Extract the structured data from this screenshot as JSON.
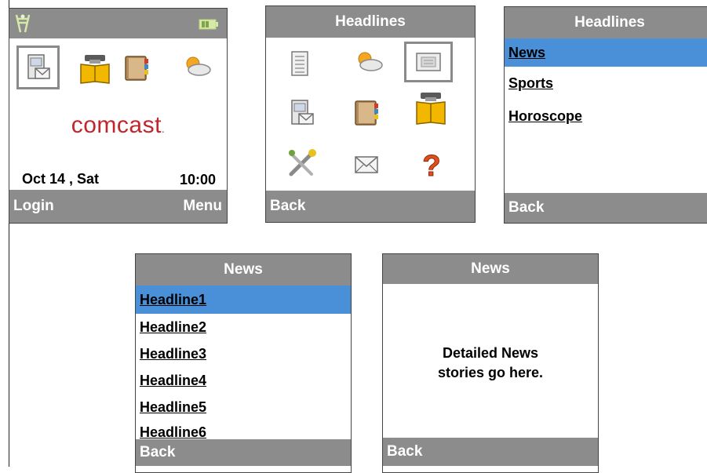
{
  "screen1": {
    "brand": "comcast",
    "brand_suffix": ".",
    "date": "Oct 14 , Sat",
    "time": "10:00",
    "soft_left": "Login",
    "soft_right": "Menu",
    "icons": [
      "signal-icon",
      "battery-icon",
      "message-icon",
      "phonebook-icon",
      "notebook-icon",
      "weather-icon"
    ]
  },
  "screen2": {
    "title": "Headlines",
    "soft_left": "Back",
    "icons": [
      "notepad-icon",
      "weather-icon",
      "news-icon",
      "message-icon",
      "notebook-icon",
      "phonebook-icon",
      "tools-icon",
      "envelope-icon",
      "help-icon"
    ],
    "selected_icon": "news-icon"
  },
  "screen3": {
    "title": "Headlines",
    "items": [
      "News",
      "Sports",
      "Horoscope"
    ],
    "selected_index": 0,
    "soft_left": "Back"
  },
  "screen4": {
    "title": "News",
    "items": [
      "Headline1",
      "Headline2",
      "Headline3",
      "Headline4",
      "Headline5",
      "Headline6"
    ],
    "selected_index": 0,
    "soft_left": "Back"
  },
  "screen5": {
    "title": "News",
    "body_line1": "Detailed News",
    "body_line2": "stories go here.",
    "soft_left": "Back"
  },
  "colors": {
    "bar": "#8c8c8c",
    "selection": "#4a90d9",
    "brand_red": "#c0262c"
  }
}
